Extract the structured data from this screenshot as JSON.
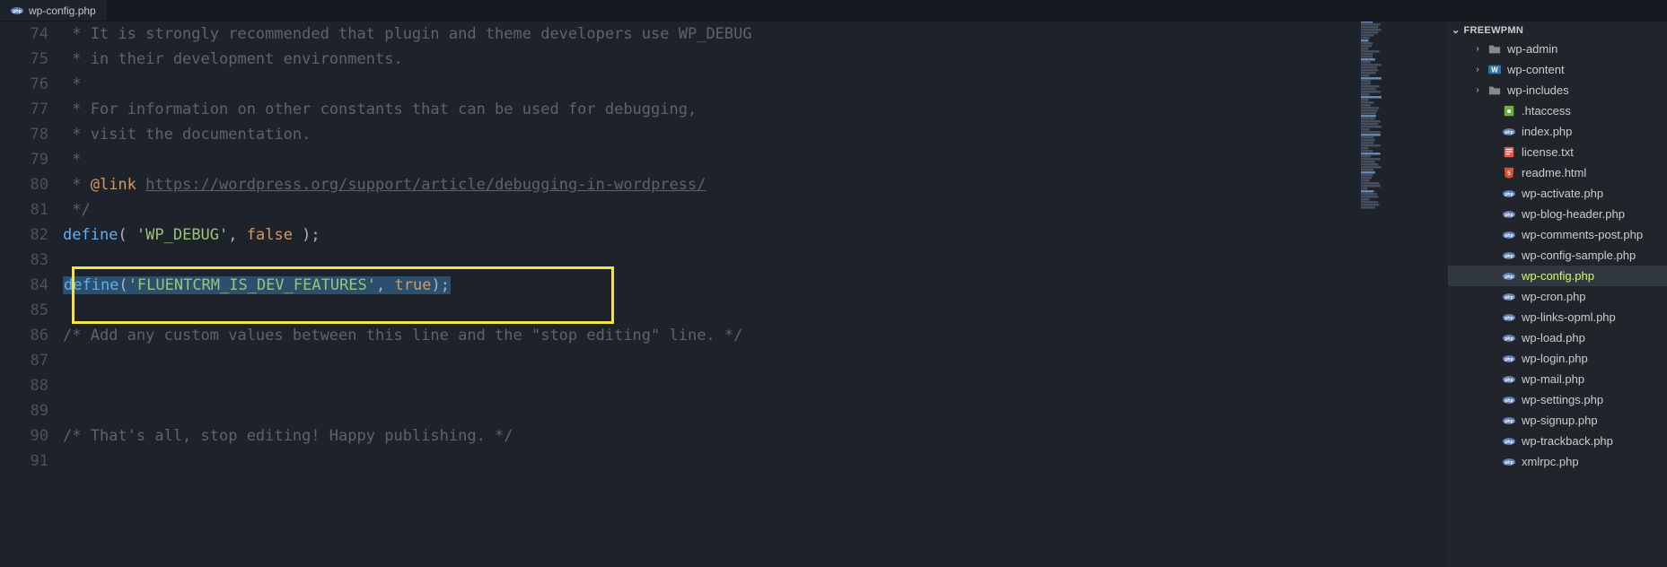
{
  "tab": {
    "filename": "wp-config.php",
    "icon": "php"
  },
  "sidebar": {
    "project": "FREEWPMN",
    "items": [
      {
        "type": "folder",
        "chev": "›",
        "icon": "folder",
        "label": "wp-admin",
        "depth": 1
      },
      {
        "type": "folder",
        "chev": "›",
        "icon": "wp",
        "label": "wp-content",
        "depth": 1
      },
      {
        "type": "folder",
        "chev": "›",
        "icon": "folder",
        "label": "wp-includes",
        "depth": 1
      },
      {
        "type": "file",
        "icon": "htaccess",
        "label": ".htaccess",
        "depth": 2
      },
      {
        "type": "file",
        "icon": "php",
        "label": "index.php",
        "depth": 2
      },
      {
        "type": "file",
        "icon": "txt",
        "label": "license.txt",
        "depth": 2
      },
      {
        "type": "file",
        "icon": "html",
        "label": "readme.html",
        "depth": 2
      },
      {
        "type": "file",
        "icon": "php",
        "label": "wp-activate.php",
        "depth": 2
      },
      {
        "type": "file",
        "icon": "php",
        "label": "wp-blog-header.php",
        "depth": 2
      },
      {
        "type": "file",
        "icon": "php",
        "label": "wp-comments-post.php",
        "depth": 2
      },
      {
        "type": "file",
        "icon": "php",
        "label": "wp-config-sample.php",
        "depth": 2
      },
      {
        "type": "file",
        "icon": "php",
        "label": "wp-config.php",
        "depth": 2,
        "active": true
      },
      {
        "type": "file",
        "icon": "php",
        "label": "wp-cron.php",
        "depth": 2
      },
      {
        "type": "file",
        "icon": "php",
        "label": "wp-links-opml.php",
        "depth": 2
      },
      {
        "type": "file",
        "icon": "php",
        "label": "wp-load.php",
        "depth": 2
      },
      {
        "type": "file",
        "icon": "php",
        "label": "wp-login.php",
        "depth": 2
      },
      {
        "type": "file",
        "icon": "php",
        "label": "wp-mail.php",
        "depth": 2
      },
      {
        "type": "file",
        "icon": "php",
        "label": "wp-settings.php",
        "depth": 2
      },
      {
        "type": "file",
        "icon": "php",
        "label": "wp-signup.php",
        "depth": 2
      },
      {
        "type": "file",
        "icon": "php",
        "label": "wp-trackback.php",
        "depth": 2
      },
      {
        "type": "file",
        "icon": "php",
        "label": "xmlrpc.php",
        "depth": 2
      }
    ]
  },
  "editor": {
    "lines": [
      {
        "n": 74,
        "tokens": [
          [
            "c-comment",
            " * It is strongly recommended that plugin and theme developers use WP_DEBUG"
          ]
        ]
      },
      {
        "n": 75,
        "tokens": [
          [
            "c-comment",
            " * in their development environments."
          ]
        ]
      },
      {
        "n": 76,
        "tokens": [
          [
            "c-comment",
            " *"
          ]
        ]
      },
      {
        "n": 77,
        "tokens": [
          [
            "c-comment",
            " * For information on other constants that can be used for debugging,"
          ]
        ]
      },
      {
        "n": 78,
        "tokens": [
          [
            "c-comment",
            " * visit the documentation."
          ]
        ]
      },
      {
        "n": 79,
        "tokens": [
          [
            "c-comment",
            " *"
          ]
        ]
      },
      {
        "n": 80,
        "tokens": [
          [
            "c-comment",
            " * "
          ],
          [
            "c-tag",
            "@link"
          ],
          [
            "c-comment",
            " "
          ],
          [
            "c-url",
            "https://wordpress.org/support/article/debugging-in-wordpress/"
          ]
        ]
      },
      {
        "n": 81,
        "tokens": [
          [
            "c-comment",
            " */"
          ]
        ]
      },
      {
        "n": 82,
        "tokens": [
          [
            "c-fn",
            "define"
          ],
          [
            "c-punct",
            "( "
          ],
          [
            "c-str",
            "'WP_DEBUG'"
          ],
          [
            "c-punct",
            ", "
          ],
          [
            "c-const",
            "false"
          ],
          [
            "c-punct",
            " );"
          ]
        ]
      },
      {
        "n": 83,
        "tokens": [
          [
            "c-white",
            ""
          ]
        ]
      },
      {
        "n": 84,
        "selected": true,
        "tokens": [
          [
            "c-fn",
            "define"
          ],
          [
            "c-punct",
            "("
          ],
          [
            "c-str",
            "'FLUENTCRM_IS_DEV_FEATURES'"
          ],
          [
            "c-punct",
            ", "
          ],
          [
            "c-const",
            "true"
          ],
          [
            "c-punct",
            ");"
          ]
        ]
      },
      {
        "n": 85,
        "tokens": [
          [
            "c-white",
            ""
          ]
        ]
      },
      {
        "n": 86,
        "tokens": [
          [
            "c-comment",
            "/* Add any custom values between this line and the \"stop editing\" line. */"
          ]
        ]
      },
      {
        "n": 87,
        "tokens": [
          [
            "c-white",
            ""
          ]
        ]
      },
      {
        "n": 88,
        "tokens": [
          [
            "c-white",
            ""
          ]
        ]
      },
      {
        "n": 89,
        "tokens": [
          [
            "c-white",
            ""
          ]
        ]
      },
      {
        "n": 90,
        "tokens": [
          [
            "c-comment",
            "/* That's all, stop editing! Happy publishing. */"
          ]
        ]
      },
      {
        "n": 91,
        "tokens": [
          [
            "c-white",
            ""
          ]
        ]
      }
    ]
  },
  "icons": {
    "folder": "folder",
    "wp": "wp",
    "php": "php",
    "htaccess": "htaccess",
    "html": "html",
    "txt": "txt"
  }
}
